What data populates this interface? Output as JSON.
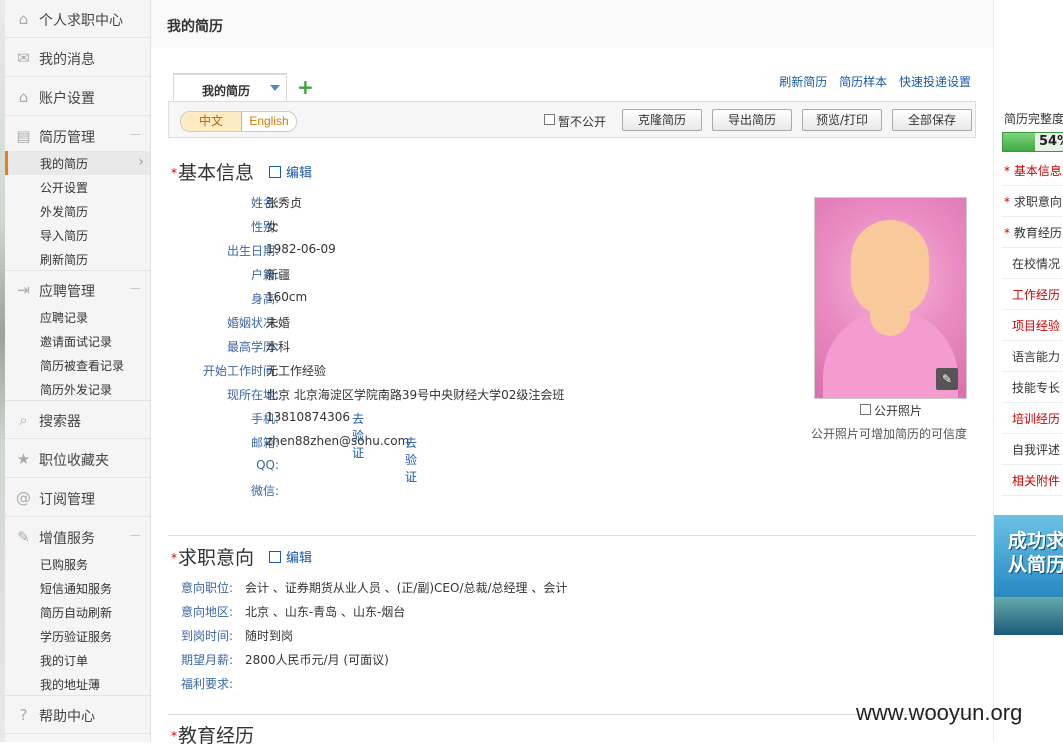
{
  "sidebar": {
    "items": [
      {
        "label": "个人求职中心",
        "icon": "home-icon"
      },
      {
        "label": "我的消息",
        "icon": "envelope-icon"
      },
      {
        "label": "账户设置",
        "icon": "home-icon"
      }
    ],
    "resume_mgmt": {
      "label": "简历管理",
      "icon": "document-icon",
      "subs": [
        "我的简历",
        "公开设置",
        "外发简历",
        "导入简历",
        "刷新简历"
      ]
    },
    "apply_mgmt": {
      "label": "应聘管理",
      "icon": "exit-icon",
      "subs": [
        "应聘记录",
        "邀请面试记录",
        "简历被查看记录",
        "简历外发记录"
      ]
    },
    "search": {
      "label": "搜索器",
      "icon": "search-icon"
    },
    "favorites": {
      "label": "职位收藏夹",
      "icon": "star-icon"
    },
    "subscribe": {
      "label": "订阅管理",
      "icon": "at-icon"
    },
    "vas": {
      "label": "增值服务",
      "icon": "pin-icon",
      "subs": [
        "已购服务",
        "短信通知服务",
        "简历自动刷新",
        "学历验证服务",
        "我的订单",
        "我的地址薄"
      ]
    },
    "help": {
      "label": "帮助中心",
      "icon": "question-icon"
    }
  },
  "header": {
    "title": "我的简历"
  },
  "tab": {
    "label": "我的简历"
  },
  "top_links": [
    "刷新简历",
    "简历样本",
    "快速投递设置"
  ],
  "toolbar": {
    "lang_cn": "中文",
    "lang_en": "English",
    "private_label": "暂不公开",
    "private_checked": false,
    "buttons": [
      "克隆简历",
      "导出简历",
      "预览/打印",
      "全部保存"
    ]
  },
  "basic": {
    "title": "基本信息",
    "edit": "编辑",
    "fields": [
      {
        "k": "姓名:",
        "v": "张秀贞"
      },
      {
        "k": "性别:",
        "v": "女"
      },
      {
        "k": "出生日期:",
        "v": "1982-06-09"
      },
      {
        "k": "户籍:",
        "v": "新疆"
      },
      {
        "k": "身高:",
        "v": "160cm"
      },
      {
        "k": "婚姻状况:",
        "v": "未婚"
      },
      {
        "k": "最高学历:",
        "v": "本科"
      },
      {
        "k": "开始工作时间:",
        "v": "无工作经验"
      },
      {
        "k": "现所在地:",
        "v": "北京 北京海淀区学院南路39号中央财经大学02级注会班"
      },
      {
        "k": "手机:",
        "v": "13810874306",
        "link": "去验证"
      },
      {
        "k": "邮箱:",
        "v": "zhen88zhen@sohu.com",
        "link": "去验证"
      },
      {
        "k": "QQ:",
        "v": ""
      },
      {
        "k": "微信:",
        "v": ""
      }
    ],
    "photo_public_label": "公开照片",
    "photo_public_checked": false,
    "photo_hint": "公开照片可增加简历的可信度"
  },
  "intent": {
    "title": "求职意向",
    "edit": "编辑",
    "fields": [
      {
        "k": "意向职位:",
        "v": "会计 、证券期货从业人员 、(正/副)CEO/总裁/总经理 、会计"
      },
      {
        "k": "意向地区:",
        "v": "北京 、山东-青岛 、山东-烟台"
      },
      {
        "k": "到岗时间:",
        "v": "随时到岗"
      },
      {
        "k": "期望月薪:",
        "v": "2800人民币元/月 (可面议)"
      },
      {
        "k": "福利要求:",
        "v": ""
      }
    ]
  },
  "education": {
    "title": "教育经历"
  },
  "completeness": {
    "title": "简历完整度",
    "percent": 54,
    "percent_label": "54%",
    "items": [
      {
        "label": "基本信息",
        "required": true,
        "color": "#cc0000"
      },
      {
        "label": "求职意向",
        "required": true,
        "color": "#333333"
      },
      {
        "label": "教育经历",
        "required": true,
        "color": "#333333"
      },
      {
        "label": "在校情况",
        "required": false,
        "color": "#333333"
      },
      {
        "label": "工作经历",
        "required": false,
        "color": "#cc0000"
      },
      {
        "label": "项目经验",
        "required": false,
        "color": "#cc0000"
      },
      {
        "label": "语言能力",
        "required": false,
        "color": "#333333"
      },
      {
        "label": "技能专长",
        "required": false,
        "color": "#333333"
      },
      {
        "label": "培训经历",
        "required": false,
        "color": "#cc0000"
      },
      {
        "label": "自我评述",
        "required": false,
        "color": "#333333"
      },
      {
        "label": "相关附件",
        "required": false,
        "color": "#cc0000"
      }
    ]
  },
  "banner": {
    "line1": "成功求",
    "line2": "从简历"
  },
  "watermark": "www.wooyun.org"
}
